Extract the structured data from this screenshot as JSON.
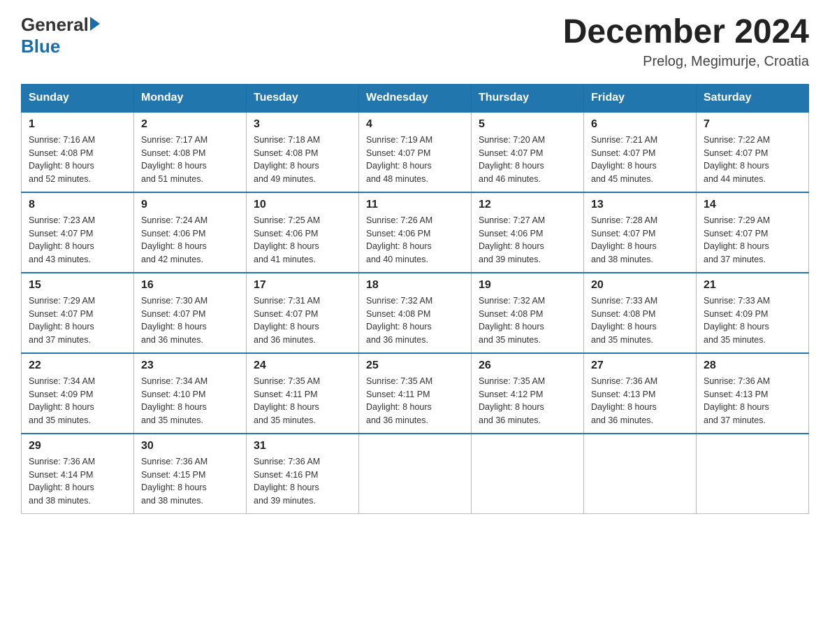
{
  "header": {
    "logo_general": "General",
    "logo_blue": "Blue",
    "title": "December 2024",
    "location": "Prelog, Megimurje, Croatia"
  },
  "days_of_week": [
    "Sunday",
    "Monday",
    "Tuesday",
    "Wednesday",
    "Thursday",
    "Friday",
    "Saturday"
  ],
  "weeks": [
    [
      {
        "day": "1",
        "sunrise": "7:16 AM",
        "sunset": "4:08 PM",
        "daylight": "8 hours and 52 minutes."
      },
      {
        "day": "2",
        "sunrise": "7:17 AM",
        "sunset": "4:08 PM",
        "daylight": "8 hours and 51 minutes."
      },
      {
        "day": "3",
        "sunrise": "7:18 AM",
        "sunset": "4:08 PM",
        "daylight": "8 hours and 49 minutes."
      },
      {
        "day": "4",
        "sunrise": "7:19 AM",
        "sunset": "4:07 PM",
        "daylight": "8 hours and 48 minutes."
      },
      {
        "day": "5",
        "sunrise": "7:20 AM",
        "sunset": "4:07 PM",
        "daylight": "8 hours and 46 minutes."
      },
      {
        "day": "6",
        "sunrise": "7:21 AM",
        "sunset": "4:07 PM",
        "daylight": "8 hours and 45 minutes."
      },
      {
        "day": "7",
        "sunrise": "7:22 AM",
        "sunset": "4:07 PM",
        "daylight": "8 hours and 44 minutes."
      }
    ],
    [
      {
        "day": "8",
        "sunrise": "7:23 AM",
        "sunset": "4:07 PM",
        "daylight": "8 hours and 43 minutes."
      },
      {
        "day": "9",
        "sunrise": "7:24 AM",
        "sunset": "4:06 PM",
        "daylight": "8 hours and 42 minutes."
      },
      {
        "day": "10",
        "sunrise": "7:25 AM",
        "sunset": "4:06 PM",
        "daylight": "8 hours and 41 minutes."
      },
      {
        "day": "11",
        "sunrise": "7:26 AM",
        "sunset": "4:06 PM",
        "daylight": "8 hours and 40 minutes."
      },
      {
        "day": "12",
        "sunrise": "7:27 AM",
        "sunset": "4:06 PM",
        "daylight": "8 hours and 39 minutes."
      },
      {
        "day": "13",
        "sunrise": "7:28 AM",
        "sunset": "4:07 PM",
        "daylight": "8 hours and 38 minutes."
      },
      {
        "day": "14",
        "sunrise": "7:29 AM",
        "sunset": "4:07 PM",
        "daylight": "8 hours and 37 minutes."
      }
    ],
    [
      {
        "day": "15",
        "sunrise": "7:29 AM",
        "sunset": "4:07 PM",
        "daylight": "8 hours and 37 minutes."
      },
      {
        "day": "16",
        "sunrise": "7:30 AM",
        "sunset": "4:07 PM",
        "daylight": "8 hours and 36 minutes."
      },
      {
        "day": "17",
        "sunrise": "7:31 AM",
        "sunset": "4:07 PM",
        "daylight": "8 hours and 36 minutes."
      },
      {
        "day": "18",
        "sunrise": "7:32 AM",
        "sunset": "4:08 PM",
        "daylight": "8 hours and 36 minutes."
      },
      {
        "day": "19",
        "sunrise": "7:32 AM",
        "sunset": "4:08 PM",
        "daylight": "8 hours and 35 minutes."
      },
      {
        "day": "20",
        "sunrise": "7:33 AM",
        "sunset": "4:08 PM",
        "daylight": "8 hours and 35 minutes."
      },
      {
        "day": "21",
        "sunrise": "7:33 AM",
        "sunset": "4:09 PM",
        "daylight": "8 hours and 35 minutes."
      }
    ],
    [
      {
        "day": "22",
        "sunrise": "7:34 AM",
        "sunset": "4:09 PM",
        "daylight": "8 hours and 35 minutes."
      },
      {
        "day": "23",
        "sunrise": "7:34 AM",
        "sunset": "4:10 PM",
        "daylight": "8 hours and 35 minutes."
      },
      {
        "day": "24",
        "sunrise": "7:35 AM",
        "sunset": "4:11 PM",
        "daylight": "8 hours and 35 minutes."
      },
      {
        "day": "25",
        "sunrise": "7:35 AM",
        "sunset": "4:11 PM",
        "daylight": "8 hours and 36 minutes."
      },
      {
        "day": "26",
        "sunrise": "7:35 AM",
        "sunset": "4:12 PM",
        "daylight": "8 hours and 36 minutes."
      },
      {
        "day": "27",
        "sunrise": "7:36 AM",
        "sunset": "4:13 PM",
        "daylight": "8 hours and 36 minutes."
      },
      {
        "day": "28",
        "sunrise": "7:36 AM",
        "sunset": "4:13 PM",
        "daylight": "8 hours and 37 minutes."
      }
    ],
    [
      {
        "day": "29",
        "sunrise": "7:36 AM",
        "sunset": "4:14 PM",
        "daylight": "8 hours and 38 minutes."
      },
      {
        "day": "30",
        "sunrise": "7:36 AM",
        "sunset": "4:15 PM",
        "daylight": "8 hours and 38 minutes."
      },
      {
        "day": "31",
        "sunrise": "7:36 AM",
        "sunset": "4:16 PM",
        "daylight": "8 hours and 39 minutes."
      },
      null,
      null,
      null,
      null
    ]
  ],
  "labels": {
    "sunrise_prefix": "Sunrise: ",
    "sunset_prefix": "Sunset: ",
    "daylight_prefix": "Daylight: "
  }
}
